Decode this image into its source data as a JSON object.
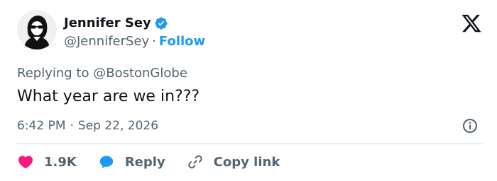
{
  "author": {
    "name": "Jennifer Sey",
    "handle": "@JenniferSey",
    "separator": "·",
    "follow_label": "Follow"
  },
  "reply_context": {
    "prefix": "Replying to",
    "mention": "@BostonGlobe"
  },
  "tweet": {
    "text": "What year are we in???",
    "time": "6:42 PM",
    "separator": "·",
    "date": "Sep 22, 2026"
  },
  "actions": {
    "like_count": "1.9K",
    "reply_label": "Reply",
    "copy_link_label": "Copy link"
  },
  "colors": {
    "accent": "#1d9bf0",
    "like": "#f91880",
    "secondary_text": "#536471",
    "primary_text": "#0f1419",
    "divider": "#cfd9de"
  },
  "icons": {
    "verified": "verified-badge-icon",
    "brand": "x-logo-icon",
    "info": "info-icon",
    "like": "heart-icon",
    "reply": "speech-bubble-icon",
    "copy_link": "link-icon"
  }
}
